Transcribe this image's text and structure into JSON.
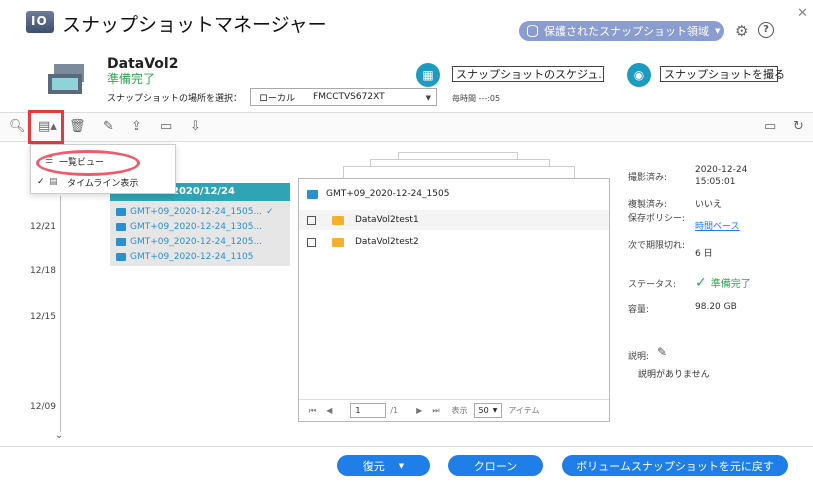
{
  "window": {
    "title": "スナップショットマネージャー",
    "protected_area": "保護されたスナップショット領域"
  },
  "volume": {
    "name": "DataVol2",
    "status": "準備完了",
    "location_label": "スナップショットの場所を選択：",
    "location_type": "ローカル",
    "location_device": "FMCCTVS672XT",
    "time_label": "毎時間 ---:05"
  },
  "actions": {
    "schedule": "スナップショットのスケジュ...",
    "take": "スナップショットを撮る"
  },
  "view_menu": {
    "items": [
      {
        "label": "一覧ビュー",
        "checked": false
      },
      {
        "label": "タイムライン表示",
        "checked": true
      }
    ]
  },
  "timeline": {
    "dates": [
      "12/21",
      "12/18",
      "12/15",
      "12/09"
    ],
    "group_date": "2020/12/24",
    "snapshots": [
      "GMT+09_2020-12-24_1505...",
      "GMT+09_2020-12-24_1305...",
      "GMT+09_2020-12-24_1205...",
      "GMT+09_2020-12-24_1105"
    ]
  },
  "panel": {
    "title": "GMT+09_2020-12-24_1505",
    "files": [
      "DataVol2test1",
      "DataVol2test2"
    ],
    "pager": {
      "page": "1",
      "total": "/1",
      "display_label": "表示",
      "per_page": "50",
      "items_label": "アイテム"
    }
  },
  "info": {
    "taken_label": "撮影済み:",
    "taken_value": "2020-12-24 15:05:01",
    "copied_label": "複製済み:",
    "copied_value": "いいえ",
    "policy_label": "保存ポリシー:",
    "policy_value": "時間ベース",
    "expire_label": "次で期限切れ:",
    "expire_value": "6 日",
    "status_label": "ステータス:",
    "status_value": "準備完了",
    "capacity_label": "容量:",
    "capacity_value": "98.20 GB",
    "desc_label": "説明:",
    "desc_value": "説明がありません"
  },
  "footer": {
    "restore": "復元",
    "clone": "クローン",
    "revert": "ボリュームスナップショットを元に戻す"
  },
  "colors": {
    "accent": "#1f7ee8",
    "teal": "#2fa4b4",
    "green": "#2fa84f",
    "highlight": "#e43b3b"
  }
}
